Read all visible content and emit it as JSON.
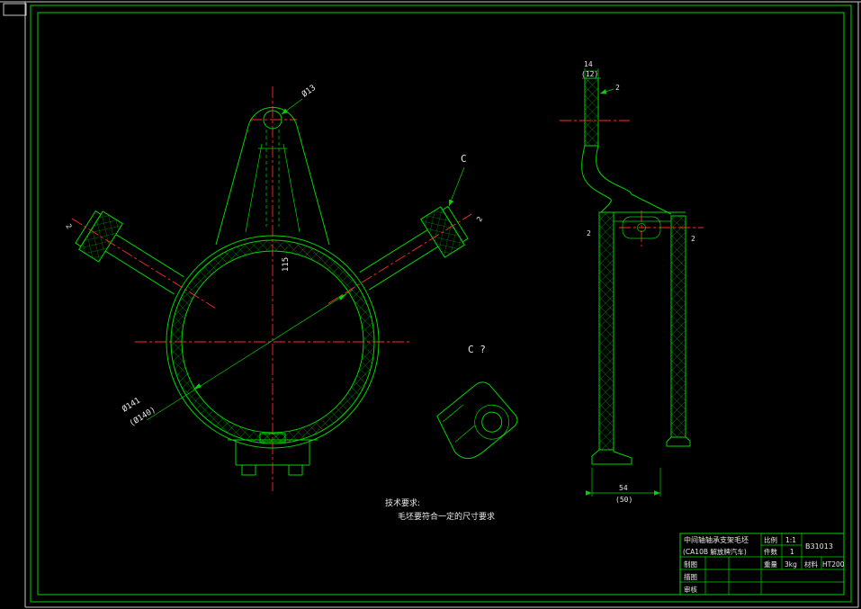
{
  "colors": {
    "background": "#000000",
    "line_green": "#00d400",
    "hatch_green": "#00a000",
    "centerline_red": "#ff2a2a",
    "text_white": "#e9e9e9",
    "chrome_white": "#c8c8c8"
  },
  "front_view": {
    "dim_hole": "Ø13",
    "dim_height": "115",
    "dim_bore": "Ø141",
    "dim_bore_alt": "(Ø140)",
    "dim_left_boss": "2",
    "dim_right_boss": "2",
    "label_c": "C"
  },
  "side_view": {
    "dim_top_width": "14",
    "dim_top_width_alt": "(12)",
    "dim_top_thickness": "2",
    "dim_left_wall": "2",
    "dim_right_wall": "2",
    "dim_bottom_width": "54",
    "dim_bottom_width_alt": "(50)"
  },
  "detail_view": {
    "label": "C ?"
  },
  "notes": {
    "title": "技术要求:",
    "line1": "毛坯要符合一定的尺寸要求"
  },
  "title_block": {
    "part_name": "中间轴轴承支架毛坯",
    "part_model": "(CA10B 解放牌汽车)",
    "scale_label": "比例",
    "scale_value": "1:1",
    "qty_label": "件数",
    "qty_value": "1",
    "weight_label": "重量",
    "weight_value": "3kg",
    "material_label": "材料",
    "material_value": "HT200",
    "drawing_number": "B31013",
    "row_draft": "制图",
    "row_trace": "描图",
    "row_check": "审核"
  }
}
